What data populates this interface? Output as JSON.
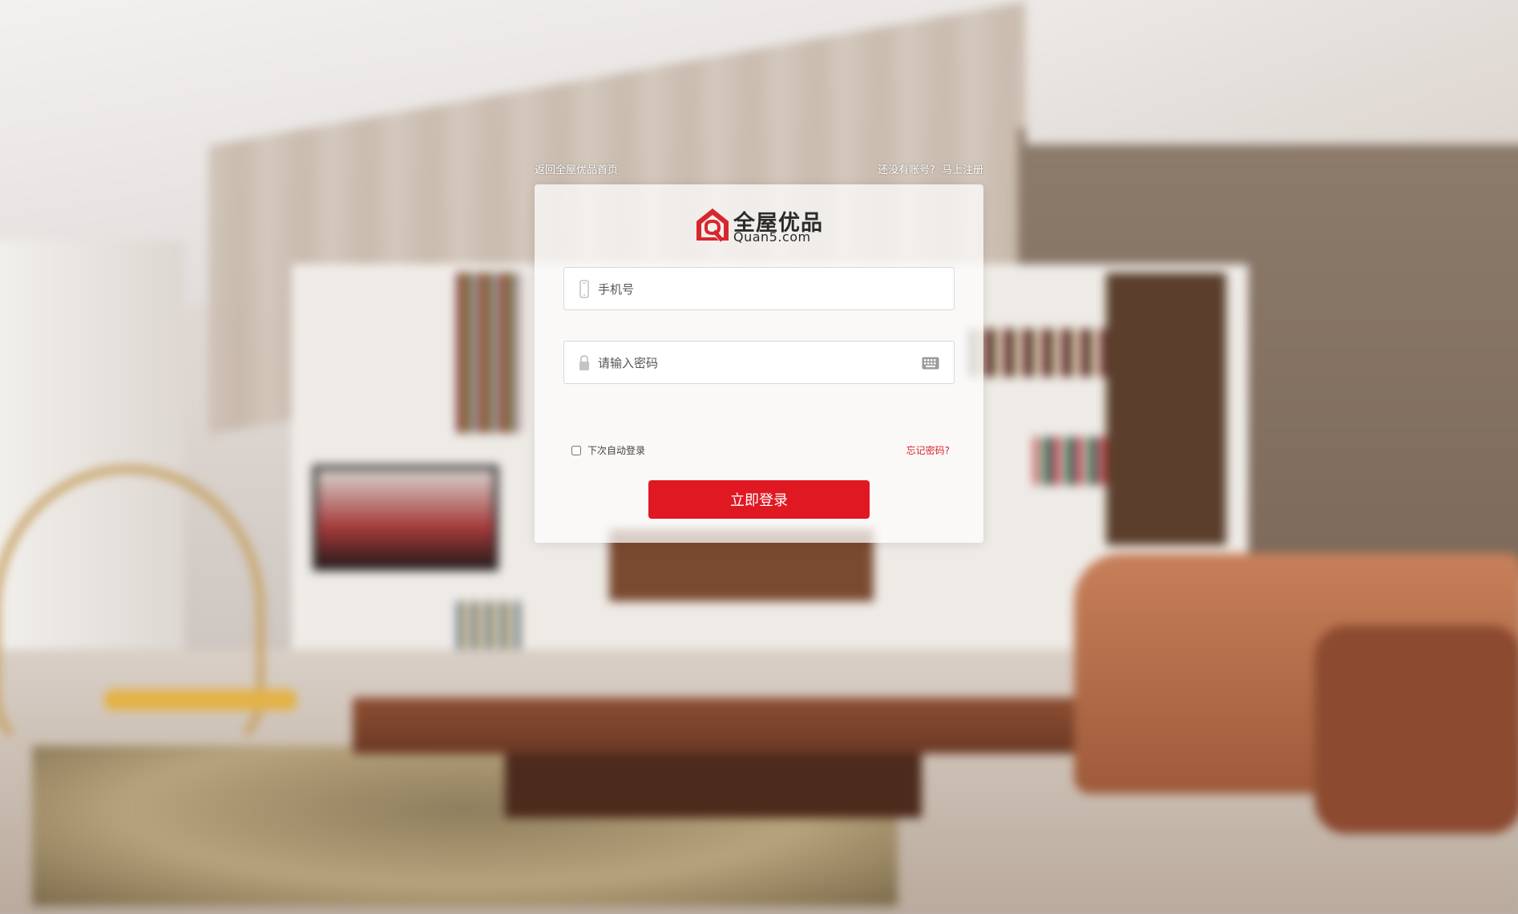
{
  "nav": {
    "back_home": "返回全屋优品首页",
    "no_account": "还没有账号?",
    "register": "马上注册"
  },
  "brand": {
    "name_cn": "全屋优品",
    "name_en": "Quan5.com",
    "color": "#d8262e"
  },
  "form": {
    "phone_placeholder": "手机号",
    "password_placeholder": "请输入密码",
    "phone_value": "",
    "password_value": "",
    "remember_label": "下次自动登录",
    "remember_checked": false,
    "forgot_label": "忘记密码?",
    "submit_label": "立即登录"
  },
  "icons": {
    "phone": "phone-icon",
    "lock": "lock-icon",
    "keyboard": "keyboard-icon",
    "logo": "house-q-logo-icon"
  },
  "colors": {
    "accent": "#e01822",
    "link_red": "#d8262e"
  }
}
